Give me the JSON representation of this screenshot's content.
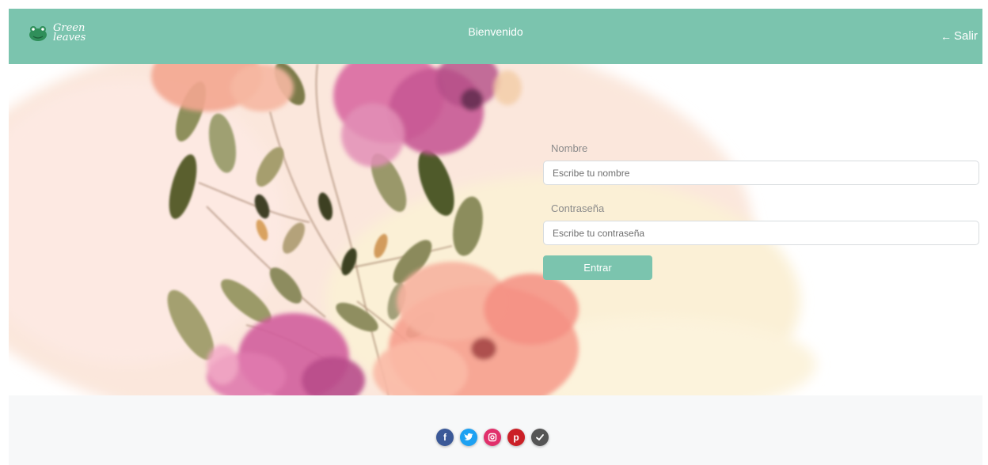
{
  "header": {
    "logo_line1": "Green",
    "logo_line2": "leaves",
    "logo_icon": "frog-logo-icon",
    "title": "Bienvenido",
    "logout_arrow": "←",
    "logout_label": "Salir",
    "bg_color": "#7bc4ae"
  },
  "form": {
    "name_label": "Nombre",
    "name_placeholder": "Escribe tu nombre",
    "name_value": "",
    "password_label": "Contraseña",
    "password_placeholder": "Escribe tu contraseña",
    "password_value": "",
    "submit_label": "Entrar"
  },
  "footer": {
    "socials": [
      {
        "name": "facebook-icon",
        "glyph": "f",
        "color": "#3b5998"
      },
      {
        "name": "twitter-icon",
        "glyph": "",
        "color": "#1da1f2"
      },
      {
        "name": "instagram-icon",
        "glyph": "",
        "color": "#e1306c"
      },
      {
        "name": "pinterest-icon",
        "glyph": "p",
        "color": "#cb2027"
      },
      {
        "name": "check-icon",
        "glyph": "",
        "color": "#555555"
      }
    ]
  },
  "colors": {
    "accent": "#7bc4ae",
    "footer_bg": "#f7f8f9"
  }
}
